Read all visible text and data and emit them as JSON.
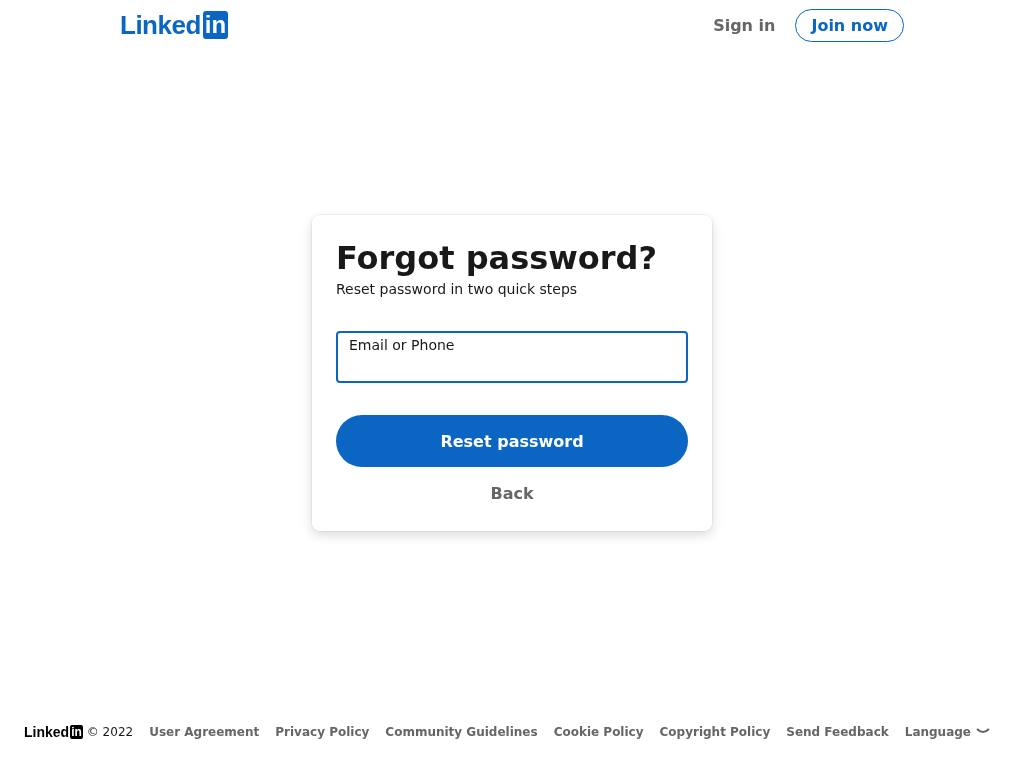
{
  "header": {
    "logo": {
      "text": "Linked",
      "badge": "in"
    },
    "sign_in": "Sign in",
    "join_now": "Join now"
  },
  "card": {
    "title": "Forgot password?",
    "subtitle": "Reset password in two quick steps",
    "field": {
      "label": "Email or Phone",
      "focused": true
    },
    "submit": "Reset password",
    "back": "Back"
  },
  "footer": {
    "logo": {
      "text": "Linked",
      "badge": "in"
    },
    "copyright": "© 2022",
    "links": [
      "User Agreement",
      "Privacy Policy",
      "Community Guidelines",
      "Cookie Policy",
      "Copyright Policy",
      "Send Feedback"
    ],
    "language": "Language"
  }
}
